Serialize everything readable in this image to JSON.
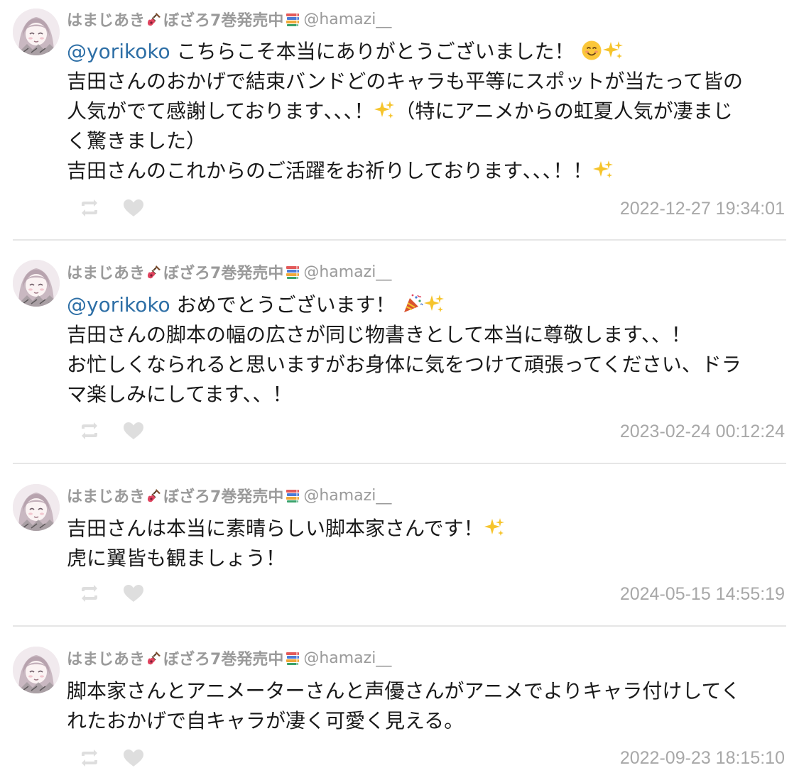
{
  "tweets": [
    {
      "display_name": "はまじあき",
      "name_mid": "ぼざろ7巻発売中",
      "handle": "@hamazi__",
      "icons": [
        "guitar-icon",
        "books-icon"
      ],
      "lines": [
        {
          "mention": "@yorikoko",
          "text": " こちらこそ本当にありがとうございました！",
          "emojis": [
            "smiling-face-icon",
            "sparkles-icon"
          ]
        },
        {
          "text": "吉田さんのおかげで結束バンドどのキャラも平等にスポットが当たって皆の"
        },
        {
          "text": "人気がでて感謝しております､､､！",
          "emojis_mid": [
            "sparkles-icon"
          ],
          "text_after": "（特にアニメからの虹夏人気が凄まじ"
        },
        {
          "text": "く驚きました）"
        },
        {
          "text": "吉田さんのこれからのご活躍をお祈りしております､､､！！",
          "emojis": [
            "sparkles-icon"
          ]
        }
      ],
      "timestamp": "2022-12-27 19:34:01"
    },
    {
      "display_name": "はまじあき",
      "name_mid": "ぼざろ7巻発売中",
      "handle": "@hamazi__",
      "icons": [
        "guitar-icon",
        "books-icon"
      ],
      "lines": [
        {
          "mention": "@yorikoko",
          "text": " おめでとうございます！",
          "emojis": [
            "party-popper-icon",
            "sparkles-icon"
          ]
        },
        {
          "text": "吉田さんの脚本の幅の広さが同じ物書きとして本当に尊敬します、、！"
        },
        {
          "text": "お忙しくなられると思いますがお身体に気をつけて頑張ってください、ドラ"
        },
        {
          "text": "マ楽しみにしてます、、！"
        }
      ],
      "timestamp": "2023-02-24 00:12:24"
    },
    {
      "display_name": "はまじあき",
      "name_mid": "ぼざろ7巻発売中",
      "handle": "@hamazi__",
      "icons": [
        "guitar-icon",
        "books-icon"
      ],
      "lines": [
        {
          "text": "吉田さんは本当に素晴らしい脚本家さんです！",
          "emojis": [
            "sparkles-icon"
          ]
        },
        {
          "text": "虎に翼皆も観ましょう！"
        }
      ],
      "timestamp": "2024-05-15 14:55:19"
    },
    {
      "display_name": "はまじあき",
      "name_mid": "ぼざろ7巻発売中",
      "handle": "@hamazi__",
      "icons": [
        "guitar-icon",
        "books-icon"
      ],
      "lines": [
        {
          "text": "脚本家さんとアニメーターさんと声優さんがアニメでよりキャラ付けしてく"
        },
        {
          "text": "れたおかげで自キャラが凄く可愛く見える。"
        }
      ],
      "timestamp": "2022-09-23 18:15:10"
    }
  ],
  "colors": {
    "mention": "#2e6fa6",
    "muted": "#9a9a9a",
    "timestamp": "#a8a8a8",
    "divider": "#e6e6e6",
    "action_icon": "#dedede"
  },
  "action_icons": [
    "retweet-icon",
    "heart-icon"
  ]
}
